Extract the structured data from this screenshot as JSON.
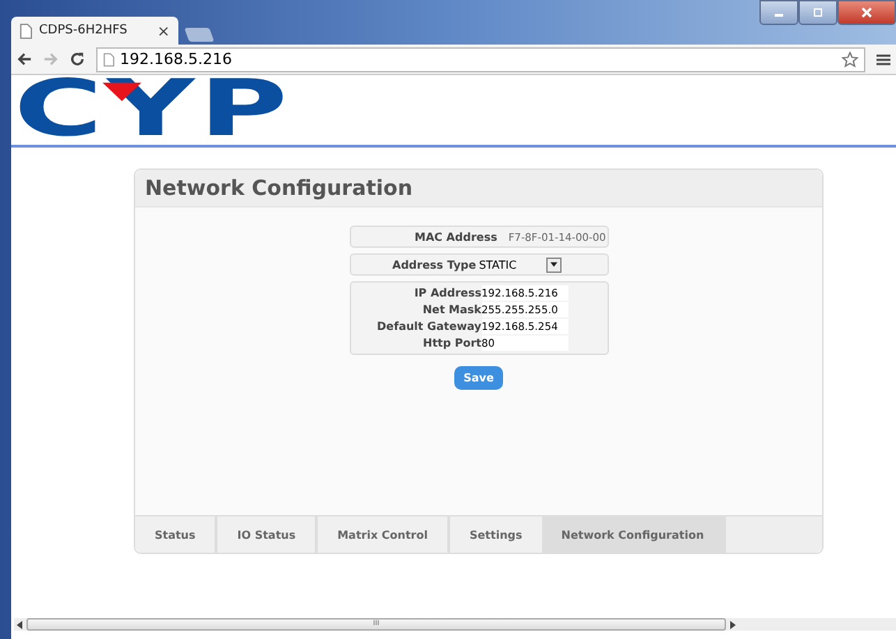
{
  "browser": {
    "tab_title": "CDPS-6H2HFS",
    "tab_close": "×",
    "address": "192.168.5.216"
  },
  "logo": {
    "text": "CYP"
  },
  "panel": {
    "title": "Network Configuration",
    "mac": {
      "label": "MAC Address",
      "value": "F7-8F-01-14-00-00"
    },
    "address_type": {
      "label": "Address Type",
      "value": "STATIC"
    },
    "fields": [
      {
        "label": "IP Address",
        "value": "192.168.5.216"
      },
      {
        "label": "Net Mask",
        "value": "255.255.255.0"
      },
      {
        "label": "Default Gateway",
        "value": "192.168.5.254"
      },
      {
        "label": "Http Port",
        "value": "80"
      }
    ],
    "save": "Save",
    "tabs": [
      {
        "label": "Status",
        "selected": false
      },
      {
        "label": "IO Status",
        "selected": false
      },
      {
        "label": "Matrix Control",
        "selected": false
      },
      {
        "label": "Settings",
        "selected": false
      },
      {
        "label": "Network Configuration",
        "selected": true
      }
    ]
  },
  "scrollbar": {
    "thumb_grip": "III"
  }
}
